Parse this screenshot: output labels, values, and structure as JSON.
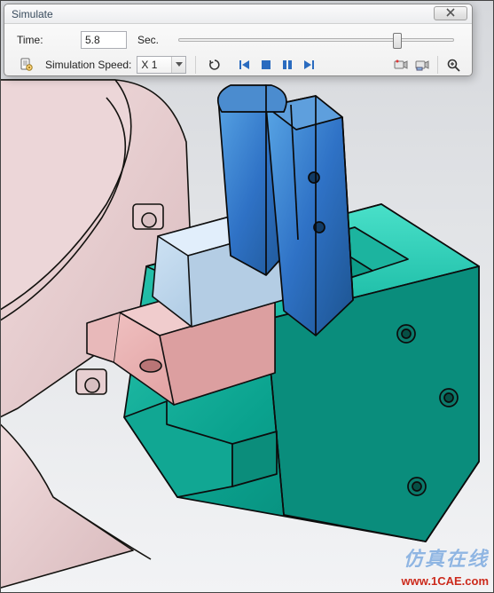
{
  "dialog": {
    "title": "Simulate",
    "time_label": "Time:",
    "time_value": "5.8",
    "time_unit": "Sec.",
    "slider_position_pct": 78,
    "speed_label": "Simulation Speed:",
    "speed_value": "X 1",
    "icons": {
      "settings": "settings",
      "refresh": "refresh",
      "step_back": "step-back",
      "stop": "stop",
      "pause": "pause",
      "step_fwd": "step-forward",
      "tool_a": "record-cam-a",
      "tool_b": "record-cam-b",
      "tool_c": "zoom-fit"
    }
  },
  "watermark": {
    "text_top": "仿真在线",
    "text_url": "www.1CAE.com"
  }
}
